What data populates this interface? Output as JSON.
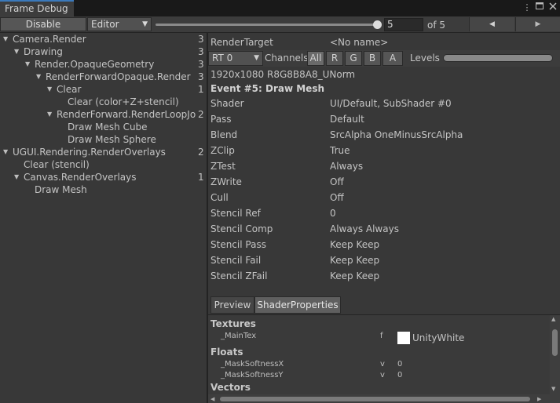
{
  "window": {
    "tab_title": "Frame Debug"
  },
  "toolbar": {
    "disable_label": "Disable",
    "editor_label": "Editor",
    "frame_value": "5",
    "of_label": "of 5",
    "prev_icon": "◀",
    "next_icon": "▶"
  },
  "tree": {
    "items": [
      {
        "label": "Camera.Render",
        "count": "3",
        "depth": 0,
        "expanded": true
      },
      {
        "label": "Drawing",
        "count": "3",
        "depth": 1,
        "expanded": true
      },
      {
        "label": "Render.OpaqueGeometry",
        "count": "3",
        "depth": 2,
        "expanded": true
      },
      {
        "label": "RenderForwardOpaque.Render",
        "count": "3",
        "depth": 3,
        "expanded": true
      },
      {
        "label": "Clear",
        "count": "1",
        "depth": 4,
        "expanded": true
      },
      {
        "label": "Clear (color+Z+stencil)",
        "count": "",
        "depth": 5,
        "expanded": null
      },
      {
        "label": "RenderForward.RenderLoopJob",
        "count": "2",
        "depth": 4,
        "expanded": true
      },
      {
        "label": "Draw Mesh Cube",
        "count": "",
        "depth": 5,
        "expanded": null
      },
      {
        "label": "Draw Mesh Sphere",
        "count": "",
        "depth": 5,
        "expanded": null
      },
      {
        "label": "UGUI.Rendering.RenderOverlays",
        "count": "2",
        "depth": 0,
        "expanded": true
      },
      {
        "label": "Clear (stencil)",
        "count": "",
        "depth": 1,
        "expanded": null
      },
      {
        "label": "Canvas.RenderOverlays",
        "count": "1",
        "depth": 1,
        "expanded": true
      },
      {
        "label": "Draw Mesh",
        "count": "",
        "depth": 2,
        "expanded": null
      }
    ]
  },
  "details": {
    "render_target_label": "RenderTarget",
    "render_target_value": "<No name>",
    "rt_dropdown": "RT 0",
    "channels_label": "Channels",
    "channel_all": "All",
    "channel_r": "R",
    "channel_g": "G",
    "channel_b": "B",
    "channel_a": "A",
    "levels_label": "Levels",
    "format": "1920x1080 R8G8B8A8_UNorm",
    "event_title": "Event #5: Draw Mesh",
    "props": [
      {
        "label": "Shader",
        "value": "UI/Default, SubShader #0"
      },
      {
        "label": "Pass",
        "value": "Default"
      },
      {
        "label": "Blend",
        "value": "SrcAlpha OneMinusSrcAlpha"
      },
      {
        "label": "ZClip",
        "value": "True"
      },
      {
        "label": "ZTest",
        "value": "Always"
      },
      {
        "label": "ZWrite",
        "value": "Off"
      },
      {
        "label": "Cull",
        "value": "Off"
      },
      {
        "label": "Stencil Ref",
        "value": "0"
      },
      {
        "label": "Stencil Comp",
        "value": "Always Always"
      },
      {
        "label": "Stencil Pass",
        "value": "Keep Keep"
      },
      {
        "label": "Stencil Fail",
        "value": "Keep Keep"
      },
      {
        "label": "Stencil ZFail",
        "value": "Keep Keep"
      }
    ],
    "tabs": {
      "preview": "Preview",
      "shader_properties": "ShaderProperties"
    },
    "textures_header": "Textures",
    "maintex_name": "_MainTex",
    "maintex_stage": "f",
    "maintex_value": "UnityWhite",
    "floats_header": "Floats",
    "floats": [
      {
        "name": "_MaskSoftnessX",
        "stage": "v",
        "value": "0"
      },
      {
        "name": "_MaskSoftnessY",
        "stage": "v",
        "value": "0"
      }
    ],
    "vectors_header": "Vectors"
  }
}
